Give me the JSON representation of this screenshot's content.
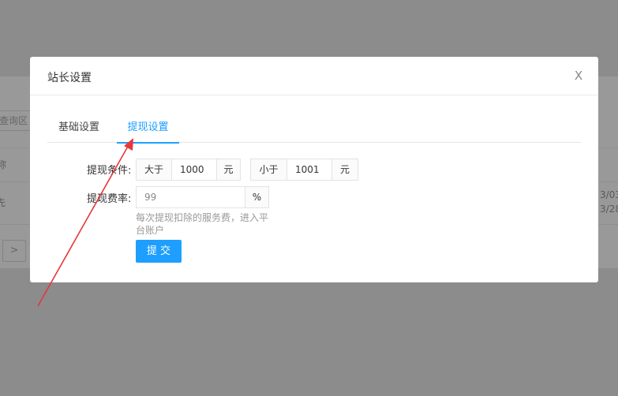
{
  "background": {
    "search_placeholder": "查询区",
    "row_marker_1": "称",
    "row_marker_2": "先",
    "date_1": "3/03",
    "date_2": "3/28",
    "next_page": ">"
  },
  "modal": {
    "title": "站长设置",
    "close_label": "X"
  },
  "tabs": [
    {
      "label": "基础设置",
      "active": false
    },
    {
      "label": "提现设置",
      "active": true
    }
  ],
  "form": {
    "condition": {
      "label": "提现条件:",
      "greater_prefix": "大于",
      "greater_value": "1000",
      "greater_unit": "元",
      "less_prefix": "小于",
      "less_value": "1001",
      "less_unit": "元"
    },
    "fee": {
      "label": "提现费率:",
      "value": "99",
      "unit": "%",
      "hint": "每次提现扣除的服务费，进入平台账户"
    },
    "submit_label": "提 交"
  },
  "annotation": {
    "arrow_color": "#e8363a"
  },
  "colors": {
    "accent": "#1e9fff"
  }
}
